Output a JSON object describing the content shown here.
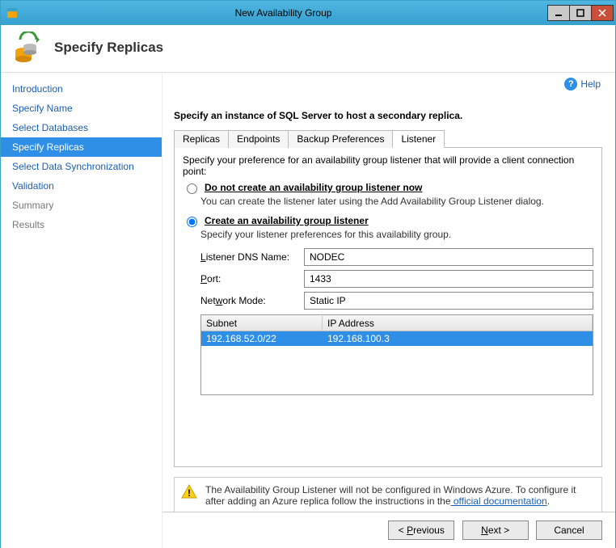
{
  "window": {
    "title": "New Availability Group"
  },
  "header": {
    "title": "Specify Replicas"
  },
  "help": {
    "label": "Help"
  },
  "sidebar": {
    "items": [
      {
        "label": "Introduction",
        "active": false,
        "clickable": true
      },
      {
        "label": "Specify Name",
        "active": false,
        "clickable": true
      },
      {
        "label": "Select Databases",
        "active": false,
        "clickable": true
      },
      {
        "label": "Specify Replicas",
        "active": true,
        "clickable": true
      },
      {
        "label": "Select Data Synchronization",
        "active": false,
        "clickable": true
      },
      {
        "label": "Validation",
        "active": false,
        "clickable": true
      },
      {
        "label": "Summary",
        "active": false,
        "clickable": false
      },
      {
        "label": "Results",
        "active": false,
        "clickable": false
      }
    ]
  },
  "main": {
    "instruction": "Specify an instance of SQL Server to host a secondary replica.",
    "tabs": [
      {
        "label": "Replicas",
        "active": false
      },
      {
        "label": "Endpoints",
        "active": false
      },
      {
        "label": "Backup Preferences",
        "active": false
      },
      {
        "label": "Listener",
        "active": true
      }
    ],
    "pane": {
      "intro": "Specify your preference for an availability group listener that will provide a client connection point:",
      "option_no_listener": {
        "label": "Do not create an availability group listener now",
        "sub": "You can create the listener later using the Add Availability Group Listener dialog."
      },
      "option_create": {
        "label": "Create an availability group listener",
        "sub": "Specify your listener preferences for this availability group."
      },
      "fields": {
        "dns_label_pre": "L",
        "dns_label_post": "istener DNS Name:",
        "dns_value": "NODEC",
        "port_label_pre": "P",
        "port_label_post": "ort:",
        "port_value": "1433",
        "mode_label_pre": "Net",
        "mode_label_u": "w",
        "mode_label_post": "ork Mode:",
        "mode_value": "Static IP"
      },
      "grid": {
        "col1": "Subnet",
        "col2": "IP Address",
        "row": {
          "subnet": "192.168.52.0/22",
          "ip": "192.168.100.3"
        }
      }
    },
    "warning": {
      "text_pre": "The Availability Group Listener will not be configured in Windows Azure. To configure it after adding an Azure replica follow the instructions in the",
      "link_text": " official documentation",
      "text_post": "."
    }
  },
  "footer": {
    "previous_pre": "< ",
    "previous_u": "P",
    "previous_post": "revious",
    "next_pre": "",
    "next_u": "N",
    "next_post": "ext >",
    "cancel": "Cancel"
  }
}
